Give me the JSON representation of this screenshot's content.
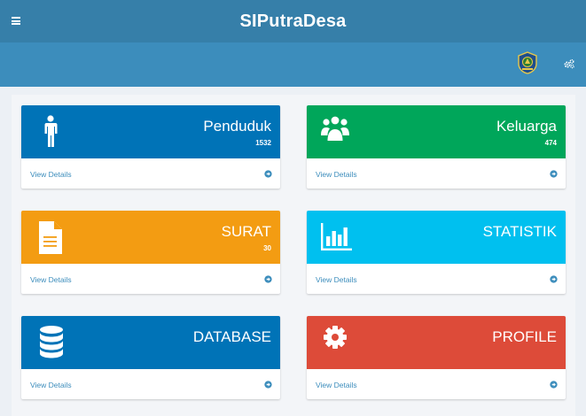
{
  "app": {
    "title": "SIPutraDesa"
  },
  "icons": {
    "menu": "menu-icon",
    "logo": "village-emblem-icon",
    "settings": "gears-icon"
  },
  "boxes": [
    {
      "label": "Penduduk",
      "count": "1532",
      "details": "View Details",
      "color": "#0073b7",
      "icon": "user-icon"
    },
    {
      "label": "Keluarga",
      "count": "474",
      "details": "View Details",
      "color": "#00a65a",
      "icon": "users-icon"
    },
    {
      "label": "SURAT",
      "count": "30",
      "details": "View Details",
      "color": "#f39c12",
      "icon": "document-icon"
    },
    {
      "label": "STATISTIK",
      "count": "",
      "details": "View Details",
      "color": "#00c0ef",
      "icon": "bar-chart-icon"
    },
    {
      "label": "DATABASE",
      "count": "",
      "details": "View Details",
      "color": "#0073b7",
      "icon": "database-icon"
    },
    {
      "label": "PROFILE",
      "count": "",
      "details": "View Details",
      "color": "#dd4b39",
      "icon": "gear-icon"
    }
  ]
}
